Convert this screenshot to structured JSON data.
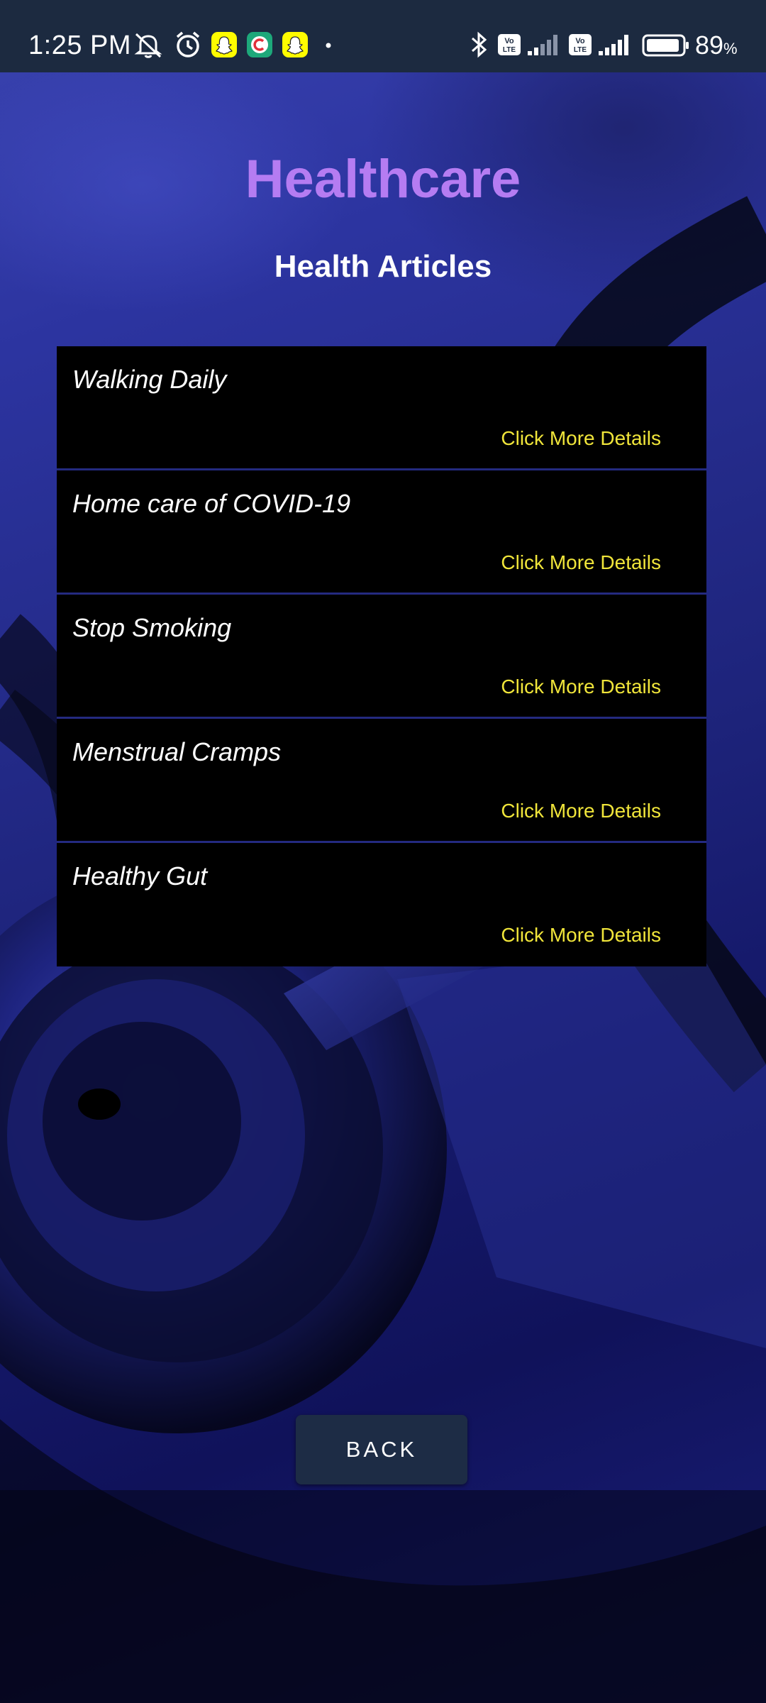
{
  "status_bar": {
    "time": "1:25 PM",
    "battery_percent": "89",
    "battery_unit": "%",
    "icons": [
      "mute-icon",
      "alarm-icon",
      "snapchat-icon",
      "app-icon",
      "snapchat-icon",
      "dot-icon",
      "bluetooth-icon",
      "volte-icon",
      "signal-icon",
      "volte-icon",
      "signal-icon",
      "battery-icon"
    ]
  },
  "header": {
    "app_title": "Healthcare",
    "section_title": "Health Articles"
  },
  "articles": [
    {
      "title": "Walking Daily",
      "link_label": "Click More Details"
    },
    {
      "title": "Home care of COVID-19",
      "link_label": "Click More Details"
    },
    {
      "title": "Stop Smoking",
      "link_label": "Click More Details"
    },
    {
      "title": "Menstrual Cramps",
      "link_label": "Click More Details"
    },
    {
      "title": "Healthy Gut",
      "link_label": "Click More Details"
    }
  ],
  "back_button": {
    "label": "BACK"
  },
  "colors": {
    "app_title": "#b57cf2",
    "link": "#f0e53a",
    "status_bar_bg": "#1c2a40",
    "button_bg": "#1d2c45",
    "list_bg": "#000000"
  }
}
